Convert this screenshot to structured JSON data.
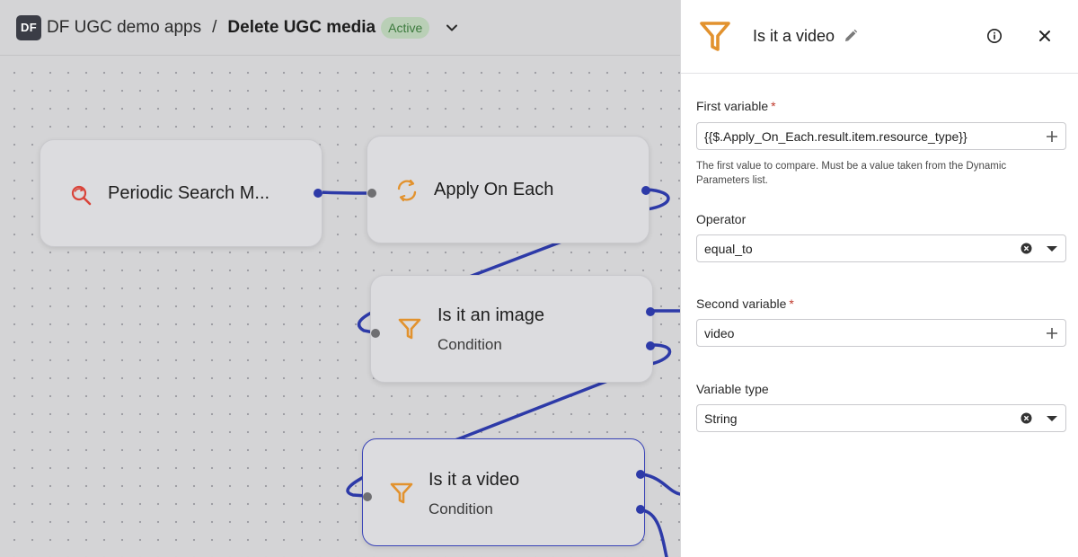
{
  "header": {
    "logo": "DF",
    "project": "DF UGC demo apps",
    "separator": "/",
    "workflow": "Delete UGC media",
    "status": "Active"
  },
  "nodes": [
    {
      "title": "Periodic Search M...",
      "subtitle": "",
      "icon": "search-refresh-icon"
    },
    {
      "title": "Apply On Each",
      "subtitle": "",
      "icon": "loop-icon"
    },
    {
      "title": "Is it an image",
      "subtitle": "Condition",
      "icon": "filter-icon"
    },
    {
      "title": "Is it a video",
      "subtitle": "Condition",
      "icon": "filter-icon"
    }
  ],
  "panel": {
    "title": "Is it a video",
    "icon": "filter-icon",
    "fields": {
      "first_variable": {
        "label": "First variable",
        "required": "*",
        "value": "{{$.Apply_On_Each.result.item.resource_type}}",
        "help": "The first value to compare. Must be a value taken from the Dynamic Parameters list."
      },
      "operator": {
        "label": "Operator",
        "value": "equal_to"
      },
      "second_variable": {
        "label": "Second variable",
        "required": "*",
        "value": "video"
      },
      "variable_type": {
        "label": "Variable type",
        "value": "String"
      }
    }
  },
  "colors": {
    "accent": "#2d3aa8",
    "condition_icon": "#e2922e",
    "loop_icon": "#e2922e",
    "search_icon": "#d9443a",
    "status_bg": "#b9cfb6",
    "status_text": "#3c7a3d"
  }
}
